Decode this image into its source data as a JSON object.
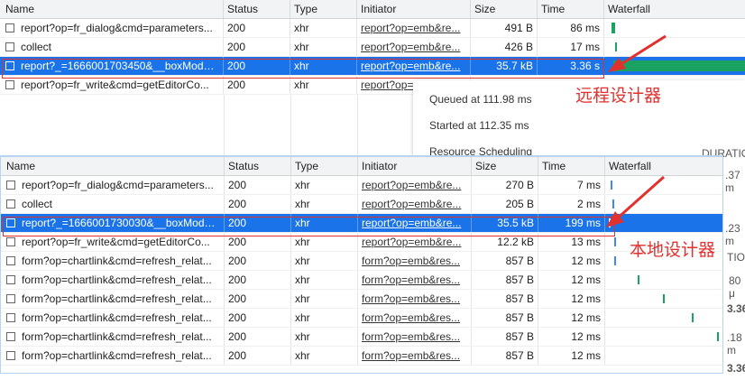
{
  "columns": [
    "Name",
    "Status",
    "Type",
    "Initiator",
    "Size",
    "Time",
    "Waterfall"
  ],
  "top_rows": [
    {
      "name": "report?op=fr_dialog&cmd=parameters...",
      "status": "200",
      "type": "xhr",
      "initiator": "report?op=emb&re...",
      "size": "491 B",
      "time": "86 ms"
    },
    {
      "name": "collect",
      "status": "200",
      "type": "xhr",
      "initiator": "report?op=emb&re...",
      "size": "426 B",
      "time": "17 ms"
    },
    {
      "name": "report?_=1666001703450&__boxModel...",
      "status": "200",
      "type": "xhr",
      "initiator": "report?op=emb&re...",
      "size": "35.7 kB",
      "time": "3.36 s"
    },
    {
      "name": "report?op=fr_write&cmd=getEditorCo...",
      "status": "200",
      "type": "xhr",
      "initiator": "report?op=",
      "size": "",
      "time": ""
    }
  ],
  "popup": {
    "queued": "Queued at 111.98 ms",
    "started": "Started at 112.35 ms",
    "resource": "Resource Scheduling"
  },
  "bottom_rows": [
    {
      "name": "report?op=fr_dialog&cmd=parameters...",
      "status": "200",
      "type": "xhr",
      "initiator": "report?op=emb&re...",
      "size": "270 B",
      "time": "7 ms"
    },
    {
      "name": "collect",
      "status": "200",
      "type": "xhr",
      "initiator": "report?op=emb&re...",
      "size": "205 B",
      "time": "2 ms"
    },
    {
      "name": "report?_=1666001730030&__boxModel...",
      "status": "200",
      "type": "xhr",
      "initiator": "report?op=emb&re...",
      "size": "35.5 kB",
      "time": "199 ms"
    },
    {
      "name": "report?op=fr_write&cmd=getEditorCo...",
      "status": "200",
      "type": "xhr",
      "initiator": "report?op=emb&re...",
      "size": "12.2 kB",
      "time": "13 ms"
    },
    {
      "name": "form?op=chartlink&cmd=refresh_relat...",
      "status": "200",
      "type": "xhr",
      "initiator": "form?op=emb&res...",
      "size": "857 B",
      "time": "12 ms"
    },
    {
      "name": "form?op=chartlink&cmd=refresh_relat...",
      "status": "200",
      "type": "xhr",
      "initiator": "form?op=emb&res...",
      "size": "857 B",
      "time": "12 ms"
    },
    {
      "name": "form?op=chartlink&cmd=refresh_relat...",
      "status": "200",
      "type": "xhr",
      "initiator": "form?op=emb&res...",
      "size": "857 B",
      "time": "12 ms"
    },
    {
      "name": "form?op=chartlink&cmd=refresh_relat...",
      "status": "200",
      "type": "xhr",
      "initiator": "form?op=emb&res...",
      "size": "857 B",
      "time": "12 ms"
    },
    {
      "name": "form?op=chartlink&cmd=refresh_relat...",
      "status": "200",
      "type": "xhr",
      "initiator": "form?op=emb&res...",
      "size": "857 B",
      "time": "12 ms"
    },
    {
      "name": "form?op=chartlink&cmd=refresh_relat...",
      "status": "200",
      "type": "xhr",
      "initiator": "form?op=emb&res...",
      "size": "857 B",
      "time": "12 ms"
    }
  ],
  "annotations": {
    "remote": "远程设计器",
    "local": "本地设计器"
  },
  "side_labels": [
    "DURATIO",
    ".37 m",
    ".23 m",
    "TIO",
    "80 μ",
    "3.36",
    ".18 m",
    "3.36"
  ],
  "colors": {
    "selected": "#1a73e8",
    "highlight": "#e0312f",
    "waterfall_green": "#1aa260",
    "waterfall_blue": "#4285f4"
  },
  "icons": [
    "checkbox-icon",
    "arrow-icon"
  ]
}
